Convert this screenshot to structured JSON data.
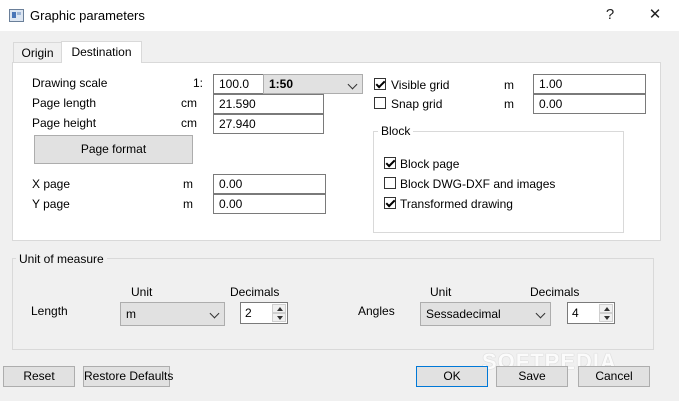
{
  "window": {
    "title": "Graphic parameters",
    "help_glyph": "?",
    "close_glyph": "✕"
  },
  "tabs": [
    {
      "label": "Origin"
    },
    {
      "label": "Destination"
    }
  ],
  "destination": {
    "drawing_scale": {
      "label": "Drawing scale",
      "prefix": "1:",
      "value": "100.0",
      "preset": "1:50"
    },
    "page_length": {
      "label": "Page length",
      "unit": "cm",
      "value": "21.590"
    },
    "page_height": {
      "label": "Page height",
      "unit": "cm",
      "value": "27.940"
    },
    "page_format_button": "Page format",
    "x_page": {
      "label": "X page",
      "unit": "m",
      "value": "0.00"
    },
    "y_page": {
      "label": "Y page",
      "unit": "m",
      "value": "0.00"
    },
    "visible_grid": {
      "label": "Visible grid",
      "checked": true,
      "unit": "m",
      "value": "1.00"
    },
    "snap_grid": {
      "label": "Snap grid",
      "checked": false,
      "unit": "m",
      "value": "0.00"
    },
    "block": {
      "title": "Block",
      "items": [
        {
          "label": "Block page",
          "checked": true
        },
        {
          "label": "Block DWG-DXF and images",
          "checked": false
        },
        {
          "label": "Transformed drawing",
          "checked": true
        }
      ]
    }
  },
  "unit_of_measure": {
    "title": "Unit of measure",
    "length": {
      "label": "Length",
      "unit_header": "Unit",
      "decimals_header": "Decimals",
      "unit_value": "m",
      "decimals_value": "2"
    },
    "angles": {
      "label": "Angles",
      "unit_header": "Unit",
      "decimals_header": "Decimals",
      "unit_value": "Sessadecimal",
      "decimals_value": "4"
    }
  },
  "buttons": {
    "reset": "Reset",
    "restore_defaults": "Restore Defaults",
    "ok": "OK",
    "save": "Save",
    "cancel": "Cancel"
  },
  "watermark": "SOFTPEDIA"
}
